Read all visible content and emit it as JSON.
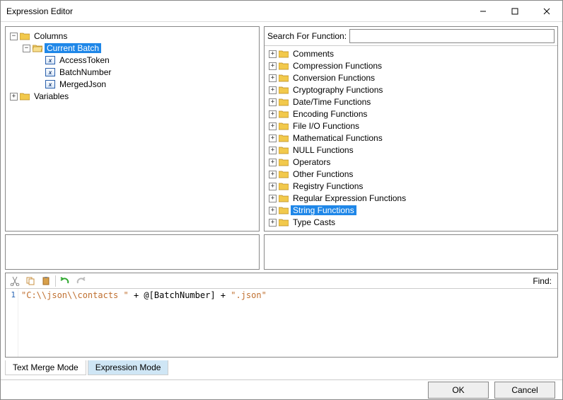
{
  "window": {
    "title": "Expression Editor"
  },
  "left_tree": {
    "nodes": [
      {
        "label": "Columns",
        "type": "folder",
        "expanded": true,
        "level": 0
      },
      {
        "label": "Current Batch",
        "type": "folder-open",
        "expanded": true,
        "level": 1,
        "selected": true
      },
      {
        "label": "AccessToken",
        "type": "var",
        "level": 2
      },
      {
        "label": "BatchNumber",
        "type": "var",
        "level": 2
      },
      {
        "label": "MergedJson",
        "type": "var",
        "level": 2
      },
      {
        "label": "Variables",
        "type": "folder",
        "expanded": false,
        "level": 0
      }
    ]
  },
  "search": {
    "label": "Search For Function:",
    "placeholder": ""
  },
  "function_tree": {
    "nodes": [
      {
        "label": "Comments"
      },
      {
        "label": "Compression Functions"
      },
      {
        "label": "Conversion Functions"
      },
      {
        "label": "Cryptography Functions"
      },
      {
        "label": "Date/Time Functions"
      },
      {
        "label": "Encoding Functions"
      },
      {
        "label": "File I/O Functions"
      },
      {
        "label": "Mathematical Functions"
      },
      {
        "label": "NULL Functions"
      },
      {
        "label": "Operators"
      },
      {
        "label": "Other Functions"
      },
      {
        "label": "Registry Functions"
      },
      {
        "label": "Regular Expression Functions"
      },
      {
        "label": "String Functions",
        "selected": true
      },
      {
        "label": "Type Casts"
      }
    ]
  },
  "toolbar": {
    "find_label": "Find:"
  },
  "editor": {
    "line_number": "1",
    "tokens": {
      "s1": "\"C:\\\\json\\\\contacts \"",
      "op1": " + ",
      "var": "@[BatchNumber]",
      "op2": " + ",
      "s2": "\".json\""
    }
  },
  "tabs": {
    "text_merge": "Text Merge Mode",
    "expression": "Expression Mode"
  },
  "footer": {
    "ok": "OK",
    "cancel": "Cancel"
  }
}
